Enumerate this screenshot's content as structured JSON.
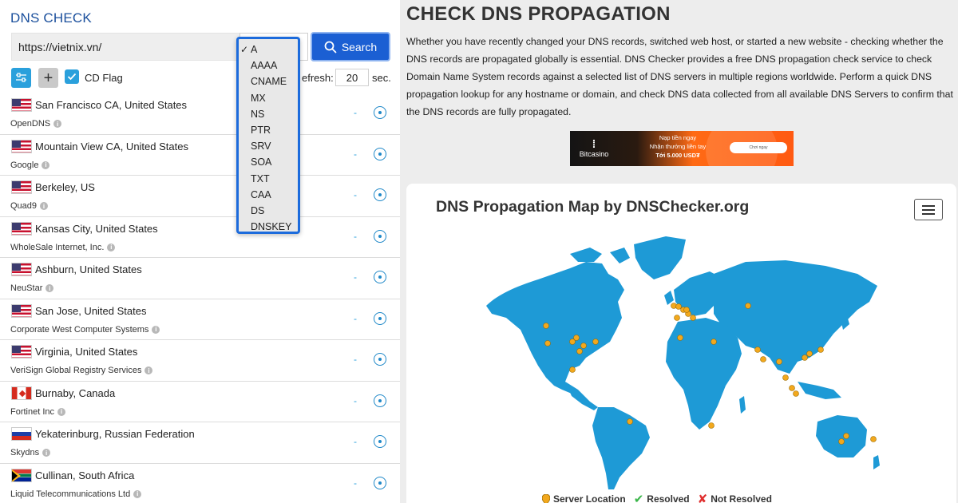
{
  "left": {
    "title": "DNS CHECK",
    "url_value": "https://vietnix.vn/",
    "search_label": "Search",
    "cd_flag_label": "CD Flag",
    "refresh_label": "efresh:",
    "refresh_value": "20",
    "sec_label": "sec."
  },
  "record_types": {
    "selected": "A",
    "options": [
      "A",
      "AAAA",
      "CNAME",
      "MX",
      "NS",
      "PTR",
      "SRV",
      "SOA",
      "TXT",
      "CAA",
      "DS",
      "DNSKEY"
    ]
  },
  "servers": [
    {
      "flag": "us",
      "city": "San Francisco CA, United States",
      "provider": "OpenDNS",
      "result": "-"
    },
    {
      "flag": "us",
      "city": "Mountain View CA, United States",
      "provider": "Google",
      "result": "-"
    },
    {
      "flag": "us",
      "city": "Berkeley, US",
      "provider": "Quad9",
      "result": "-"
    },
    {
      "flag": "us",
      "city": "Kansas City, United States",
      "provider": "WholeSale Internet, Inc.",
      "result": "-"
    },
    {
      "flag": "us",
      "city": "Ashburn, United States",
      "provider": "NeuStar",
      "result": "-"
    },
    {
      "flag": "us",
      "city": "San Jose, United States",
      "provider": "Corporate West Computer Systems",
      "result": "-"
    },
    {
      "flag": "us",
      "city": "Virginia, United States",
      "provider": "VeriSign Global Registry Services",
      "result": "-"
    },
    {
      "flag": "ca",
      "city": "Burnaby, Canada",
      "provider": "Fortinet Inc",
      "result": "-"
    },
    {
      "flag": "ru",
      "city": "Yekaterinburg, Russian Federation",
      "provider": "Skydns",
      "result": "-"
    },
    {
      "flag": "za",
      "city": "Cullinan, South Africa",
      "provider": "Liquid Telecommunications Ltd",
      "result": "-"
    }
  ],
  "right": {
    "title": "CHECK DNS PROPAGATION",
    "description": "Whether you have recently changed your DNS records, switched web host, or started a new website - checking whether the DNS records are propagated globally is essential. DNS Checker provides a free DNS propagation check service to check Domain Name System records against a selected list of DNS servers in multiple regions worldwide. Perform a quick DNS propagation lookup for any hostname or domain, and check DNS data collected from all available DNS Servers to confirm that the DNS records are fully propagated."
  },
  "banner": {
    "brand": "Bitcasino",
    "line1": "Nạp tiền ngay",
    "line2": "Nhận thưởng liền tay",
    "line3": "Tới 5.000 USD₮",
    "button": "Chơi ngay"
  },
  "map": {
    "title": "DNS Propagation Map by DNSChecker.org",
    "legend_server": "Server Location",
    "legend_resolved": "Resolved",
    "legend_not_resolved": "Not Resolved",
    "land_color": "#1e9ad6",
    "pin_color": "#f2a81d"
  },
  "colors": {
    "brand_blue": "#1a4f9c",
    "search_button": "#1b5fd3",
    "accent": "#2aa0dc"
  }
}
